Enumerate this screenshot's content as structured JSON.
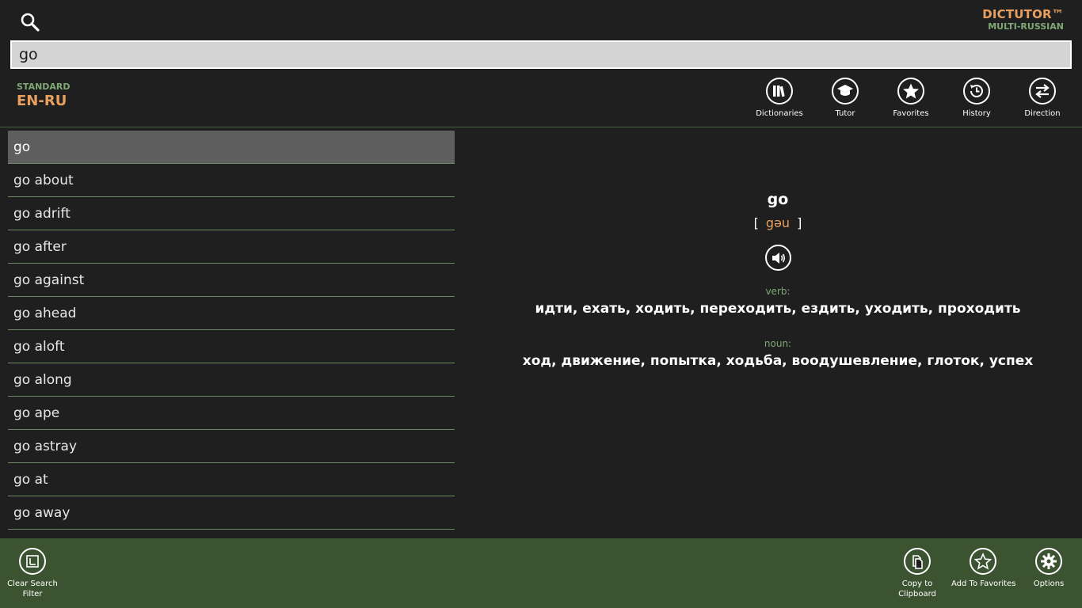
{
  "app": {
    "title": "DICTUTOR™",
    "subtitle": "MULTI-RUSSIAN"
  },
  "search": {
    "value": "go",
    "icon": "search-icon"
  },
  "dictionary": {
    "mode": "STANDARD",
    "pair": "EN-RU"
  },
  "toolbar": {
    "dictionaries": "Dictionaries",
    "tutor": "Tutor",
    "favorites": "Favorites",
    "history": "History",
    "direction": "Direction"
  },
  "word_list": [
    "go",
    "go about",
    "go adrift",
    "go after",
    "go against",
    "go ahead",
    "go aloft",
    "go along",
    "go ape",
    "go astray",
    "go at",
    "go away"
  ],
  "selected_index": 0,
  "entry": {
    "word": "go",
    "bracket_open": "[",
    "phonetic": "gəu",
    "bracket_close": "]",
    "senses": [
      {
        "pos": "verb:",
        "translation": "идти, ехать, ходить, переходить, ездить, уходить, проходить"
      },
      {
        "pos": "noun:",
        "translation": "ход, движение, попытка, ходьба, воодушевление, глоток, успех"
      }
    ]
  },
  "appbar": {
    "clear_filter": "Clear Search Filter",
    "copy": "Copy to Clipboard",
    "add_favorites": "Add To Favorites",
    "options": "Options"
  },
  "colors": {
    "accent_orange": "#e8a060",
    "accent_green": "#7fa874",
    "appbar_bg": "#3c5331",
    "background": "#1f1f1f"
  }
}
